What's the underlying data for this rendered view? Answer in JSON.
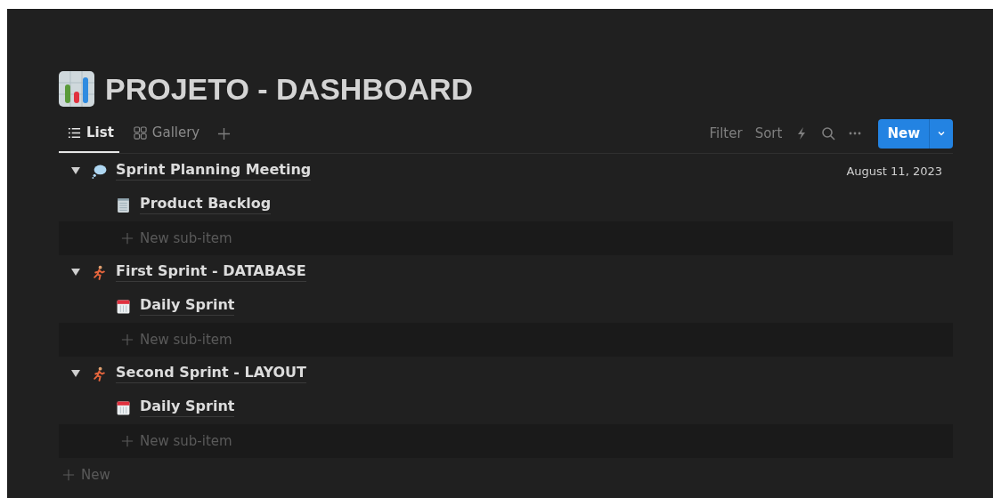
{
  "page": {
    "title": "PROJETO - DASHBOARD"
  },
  "views": [
    {
      "label": "List",
      "kind": "list",
      "selected": true
    },
    {
      "label": "Gallery",
      "kind": "gallery",
      "selected": false
    }
  ],
  "toolbar": {
    "filter": "Filter",
    "sort": "Sort",
    "new_button": "New"
  },
  "items": [
    {
      "title": "Sprint Planning Meeting",
      "kind": "thought",
      "expanded": true,
      "date": "August 11, 2023",
      "children": [
        {
          "title": "Product Backlog",
          "kind": "notepad"
        }
      ],
      "add_sub_item": "New sub-item"
    },
    {
      "title": "First Sprint - DATABASE",
      "kind": "runner",
      "expanded": true,
      "children": [
        {
          "title": "Daily Sprint",
          "kind": "calendar"
        }
      ],
      "add_sub_item": "New sub-item"
    },
    {
      "title": "Second Sprint - LAYOUT",
      "kind": "runner",
      "expanded": true,
      "children": [
        {
          "title": "Daily Sprint",
          "kind": "calendar"
        }
      ],
      "add_sub_item": "New sub-item"
    }
  ],
  "add_item": "New"
}
